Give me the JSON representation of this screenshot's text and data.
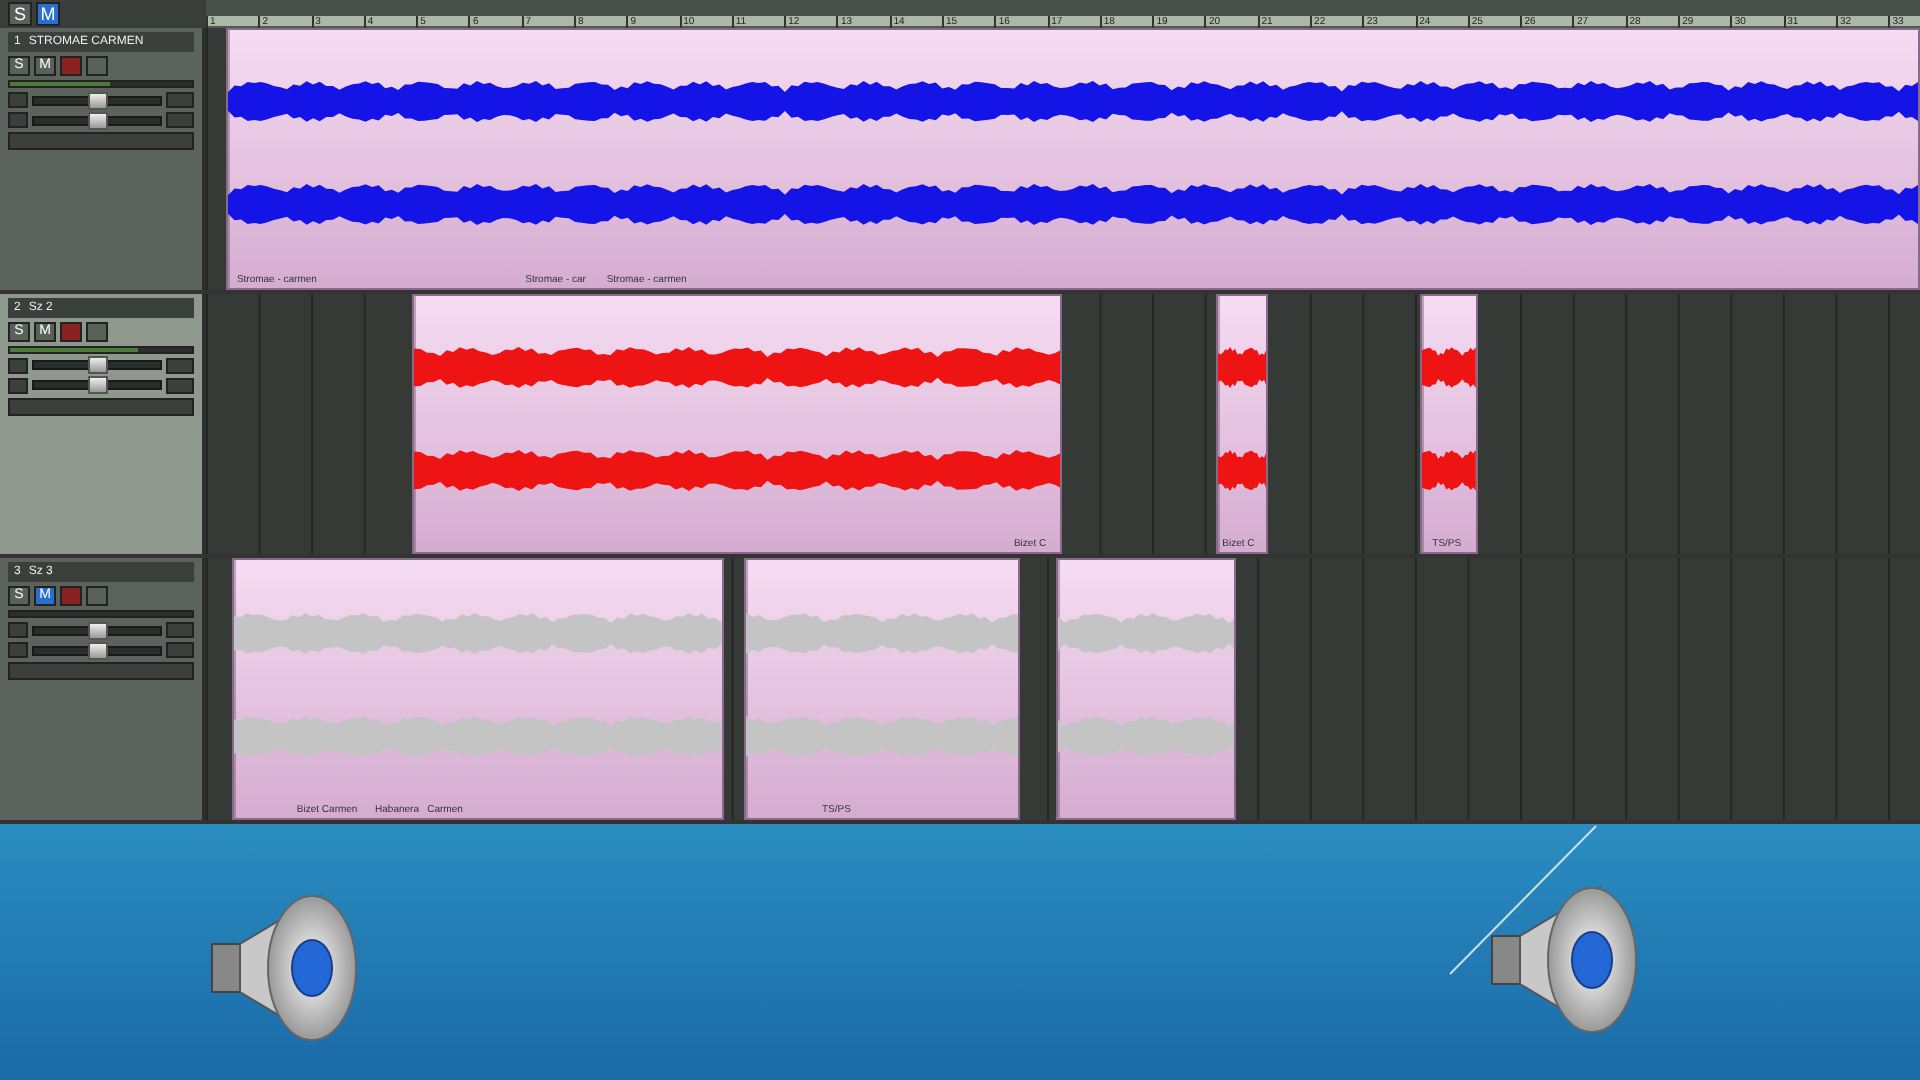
{
  "toolbar": {
    "buttons": [
      {
        "label": "S",
        "selected": false
      },
      {
        "label": "M",
        "selected": true
      }
    ]
  },
  "ruler": {
    "labels": [
      "1",
      "2",
      "3",
      "4",
      "5",
      "6",
      "7",
      "8",
      "9",
      "10",
      "11",
      "12",
      "13",
      "14",
      "15",
      "16",
      "17",
      "18",
      "19",
      "20",
      "21",
      "22",
      "23",
      "24",
      "25",
      "26",
      "27",
      "28",
      "29",
      "30",
      "31",
      "32",
      "33"
    ]
  },
  "tracks": [
    {
      "number": "1",
      "name": "STROMAE CARMEN",
      "solo_label": "S",
      "mute_label": "M",
      "muted": false,
      "armed": true,
      "color": "#1414e6",
      "volume": {
        "level": 0.5
      },
      "pan": {
        "level": 0.5
      },
      "meter": {
        "level": 0.55
      },
      "clips": [
        {
          "kind": "audio",
          "labels": [
            "Stromae - carmen",
            "Stromae - car",
            "Stromae - carmen"
          ]
        }
      ]
    },
    {
      "number": "2",
      "name": "Sz 2",
      "solo_label": "S",
      "mute_label": "M",
      "muted": false,
      "armed": true,
      "color": "#ee1414",
      "volume": {
        "level": 0.5
      },
      "pan": {
        "level": 0.5
      },
      "meter": {
        "level": 0.7
      },
      "clips": [
        {
          "kind": "audio",
          "labels": [
            "Bizet C"
          ]
        },
        {
          "kind": "audio",
          "labels": [
            "Bizet C"
          ]
        },
        {
          "kind": "audio",
          "labels": [
            "TS/PS"
          ]
        }
      ]
    },
    {
      "number": "3",
      "name": "Sz 3",
      "solo_label": "S",
      "mute_label": "M",
      "muted": true,
      "armed": true,
      "color": "#c4c4c4",
      "volume": {
        "level": 0.5
      },
      "pan": {
        "level": 0.5
      },
      "clips": [
        {
          "kind": "audio",
          "labels": [
            "Bizet Carmen",
            "Habanera",
            "Carmen"
          ]
        },
        {
          "kind": "audio",
          "labels": [
            "TS/PS"
          ]
        },
        {
          "kind": "audio"
        }
      ]
    }
  ]
}
